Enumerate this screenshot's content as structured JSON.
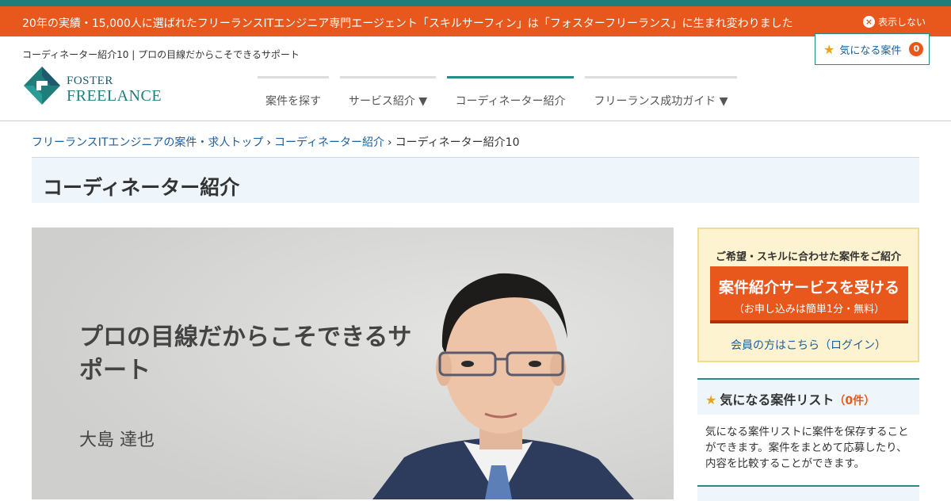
{
  "notice": {
    "text": "20年の実績・15,000人に選ばれたフリーランスITエンジニア専門エージェント「スキルサーフィン」は「フォスターフリーランス」に生まれ変わりました",
    "close_label": "表示しない",
    "close_icon": "×"
  },
  "header": {
    "tagline": "コーディネーター紹介10 | プロの目線だからこそできるサポート",
    "logo_line1": "FOSTER",
    "logo_line2": "FREELANCE",
    "favorites_label": "気になる案件",
    "favorites_count": "0",
    "nav": [
      {
        "label": "案件を探す"
      },
      {
        "label": "サービス紹介 ▼"
      },
      {
        "label": "コーディネーター紹介"
      },
      {
        "label": "フリーランス成功ガイド ▼"
      }
    ]
  },
  "breadcrumb": {
    "items": [
      {
        "label": "フリーランスITエンジニアの案件・求人トップ"
      },
      {
        "label": "コーディネーター紹介"
      },
      {
        "label": "コーディネーター紹介10"
      }
    ],
    "separator": "›"
  },
  "page": {
    "title": "コーディネーター紹介"
  },
  "hero": {
    "heading": "プロの目線だからこそできるサポート",
    "name": "大島 達也"
  },
  "sidebar": {
    "cta_lead": "ご希望・スキルに合わせた案件をご紹介",
    "cta_main": "案件紹介サービスを受ける",
    "cta_sub": "（お申し込みは簡単1分・無料）",
    "login_link": "会員の方はこちら（ログイン）",
    "fav_list_title": "気になる案件リスト",
    "fav_list_count": "（0件）",
    "fav_list_desc": "気になる案件リストに案件を保存することができます。案件をまとめて応募したり、内容を比較することができます。"
  },
  "colors": {
    "brand_teal": "#1f7d7a",
    "accent_orange": "#e8571c",
    "link_blue": "#1a5fa0",
    "star_yellow": "#e8a317"
  }
}
